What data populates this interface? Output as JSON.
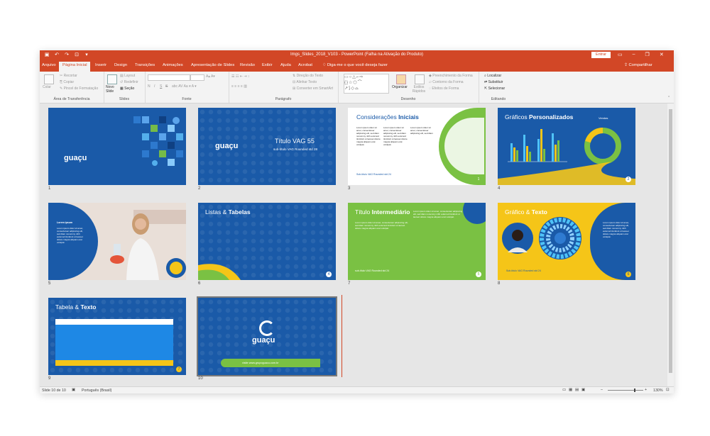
{
  "titlebar": {
    "title": "Imgs_Slides_2018_V103  -  PowerPoint (Falha na Ativação do Produto)",
    "signin": "Entrar",
    "qat_icons": [
      "save-icon",
      "undo-icon",
      "redo-icon",
      "present-icon",
      "customize-icon"
    ]
  },
  "tabs": [
    "Arquivo",
    "Página Inicial",
    "Inserir",
    "Design",
    "Transições",
    "Animações",
    "Apresentação de Slides",
    "Revisão",
    "Exibir",
    "Ajuda",
    "Acrobat"
  ],
  "tellme": "Diga-me o que você deseja fazer",
  "share": "Compartilhar",
  "ribbon": {
    "clipboard": {
      "paste": "Colar",
      "cut": "Recortar",
      "copy": "Copiar",
      "format_painter": "Pincel de Formatação",
      "label": "Área de Transferência"
    },
    "slides": {
      "new_slide": "Novo Slide",
      "layout": "Layout",
      "reset": "Redefinir",
      "section": "Seção",
      "label": "Slides"
    },
    "font": {
      "bold": "N",
      "italic": "I",
      "underline": "S",
      "strike": "S",
      "label": "Fonte"
    },
    "paragraph": {
      "text_direction": "Direção do Texto",
      "align_text": "Alinhar Texto",
      "smartart": "Converter em SmartArt",
      "label": "Parágrafo"
    },
    "drawing": {
      "arrange": "Organizar",
      "quick_styles": "Estilos Rápidos",
      "fill": "Preenchimento da Forma",
      "outline": "Contorno da Forma",
      "effects": "Efeitos de Forma",
      "label": "Desenho"
    },
    "editing": {
      "find": "Localizar",
      "replace": "Substituir",
      "select": "Selecionar",
      "label": "Editando"
    }
  },
  "slides": [
    {
      "num": "1",
      "logo": "guaçu"
    },
    {
      "num": "2",
      "logo": "guaçu",
      "title": "Título VAG 55",
      "subtitle": "sub-título VAG Rounded std 28"
    },
    {
      "num": "3",
      "title_a": "Considerações ",
      "title_b": "Iniciais",
      "footer": "Sub-título VAG Rounded std 24",
      "page": "1"
    },
    {
      "num": "4",
      "title_a": "Gráficos ",
      "title_b": "Personalizados",
      "legend": "Vendas",
      "page": "2"
    },
    {
      "num": "5",
      "label": "Lorem ipsum"
    },
    {
      "num": "6",
      "title_a": "Listas & ",
      "title_b": "Tabelas",
      "page": "4"
    },
    {
      "num": "7",
      "title_a": "Título ",
      "title_b": "Intermediário",
      "footer": "sub-título VAG Rounded std 24",
      "page": "5"
    },
    {
      "num": "8",
      "title_a": "Gráfico & ",
      "title_b": "Texto",
      "footer": "Sub-título VAG Rounded std 24",
      "page": "6"
    },
    {
      "num": "9",
      "title_a": "Tabela & ",
      "title_b": "Texto",
      "page": "7"
    },
    {
      "num": "10",
      "logo": "guaçu",
      "url": "visite www.grupoguacu.com.br"
    }
  ],
  "lorem": "Lorem ipsum dolor sit amet, consectetuer adipiscing elit, sed diam nonummy nibh euismod tincidunt ut laoreet dolore magna aliquam erat volutpat.",
  "status": {
    "slide": "Slide 10 de 10",
    "language": "Português (Brasil)",
    "zoom": "130%"
  },
  "colors": {
    "accent": "#d24726",
    "brand_blue": "#1a5aa8",
    "brand_green": "#7ac143",
    "brand_yellow": "#f5c518"
  }
}
